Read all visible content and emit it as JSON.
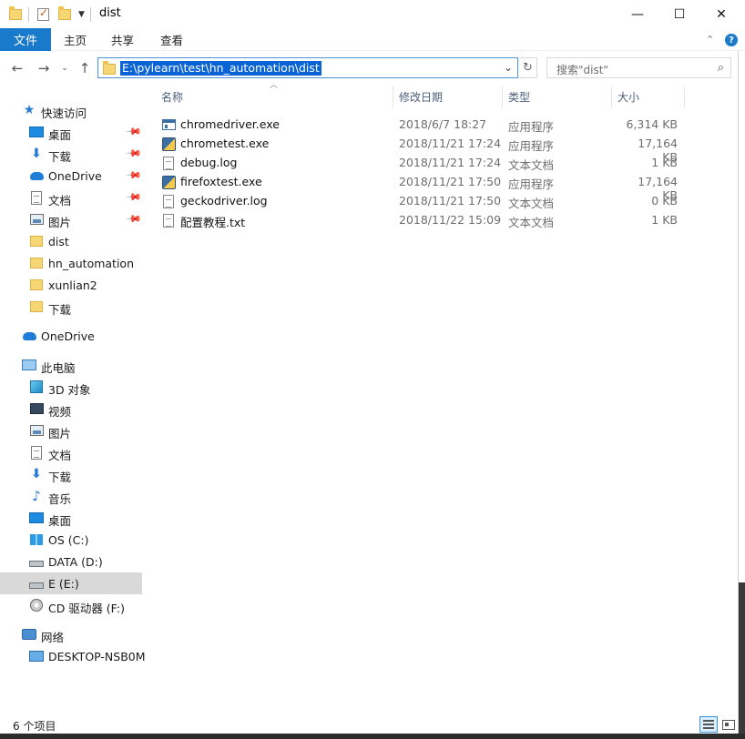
{
  "window": {
    "title": "dist",
    "minimize_glyph": "—",
    "maximize_glyph": "☐",
    "close_glyph": "✕"
  },
  "ribbon": {
    "tabs": [
      "文件",
      "主页",
      "共享",
      "查看"
    ],
    "active_tab": "文件",
    "accent": "#1979ca"
  },
  "address": {
    "path": "E:\\pylearn\\test\\hn_automation\\dist",
    "search_placeholder": "搜索\"dist\""
  },
  "columns": {
    "name": "名称",
    "date": "修改日期",
    "type": "类型",
    "size": "大小"
  },
  "files": [
    {
      "name": "chromedriver.exe",
      "date": "2018/6/7 18:27",
      "type": "应用程序",
      "size": "6,314 KB",
      "icon": "exe-window-icon"
    },
    {
      "name": "chrometest.exe",
      "date": "2018/11/21 17:24",
      "type": "应用程序",
      "size": "17,164 KB",
      "icon": "python-exe-icon"
    },
    {
      "name": "debug.log",
      "date": "2018/11/21 17:24",
      "type": "文本文档",
      "size": "1 KB",
      "icon": "text-file-icon"
    },
    {
      "name": "firefoxtest.exe",
      "date": "2018/11/21 17:50",
      "type": "应用程序",
      "size": "17,164 KB",
      "icon": "python-exe-icon"
    },
    {
      "name": "geckodriver.log",
      "date": "2018/11/21 17:50",
      "type": "文本文档",
      "size": "0 KB",
      "icon": "text-file-icon"
    },
    {
      "name": "配置教程.txt",
      "date": "2018/11/22 15:09",
      "type": "文本文档",
      "size": "1 KB",
      "icon": "text-file-icon"
    }
  ],
  "nav": {
    "quick_access": "快速访问",
    "quick_items": [
      {
        "label": "桌面",
        "icon": "desktop-icon",
        "pinned": true
      },
      {
        "label": "下载",
        "icon": "download-icon",
        "pinned": true
      },
      {
        "label": "OneDrive",
        "icon": "onedrive-icon",
        "pinned": true
      },
      {
        "label": "文档",
        "icon": "documents-icon",
        "pinned": true
      },
      {
        "label": "图片",
        "icon": "pictures-icon",
        "pinned": true
      },
      {
        "label": "dist",
        "icon": "folder-icon",
        "pinned": false
      },
      {
        "label": "hn_automation",
        "icon": "folder-icon",
        "pinned": false
      },
      {
        "label": "xunlian2",
        "icon": "folder-icon",
        "pinned": false
      },
      {
        "label": "下载",
        "icon": "folder-icon",
        "pinned": false
      }
    ],
    "onedrive": "OneDrive",
    "this_pc": "此电脑",
    "pc_items": [
      {
        "label": "3D 对象",
        "icon": "3d-objects-icon"
      },
      {
        "label": "视频",
        "icon": "videos-icon"
      },
      {
        "label": "图片",
        "icon": "pictures-icon"
      },
      {
        "label": "文档",
        "icon": "documents-icon"
      },
      {
        "label": "下载",
        "icon": "download-icon"
      },
      {
        "label": "音乐",
        "icon": "music-icon"
      },
      {
        "label": "桌面",
        "icon": "desktop-icon"
      },
      {
        "label": "OS (C:)",
        "icon": "windows-drive-icon"
      },
      {
        "label": "DATA (D:)",
        "icon": "drive-icon"
      },
      {
        "label": "E (E:)",
        "icon": "drive-icon",
        "selected": true
      },
      {
        "label": "CD 驱动器 (F:)",
        "icon": "cd-drive-icon"
      }
    ],
    "network": "网络",
    "network_items": [
      {
        "label": "DESKTOP-NSB0M",
        "icon": "computer-icon"
      }
    ]
  },
  "status": {
    "item_count": "6 个项目"
  }
}
